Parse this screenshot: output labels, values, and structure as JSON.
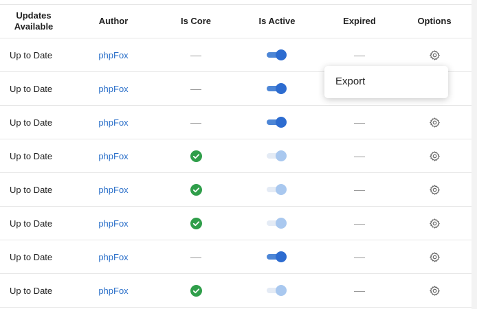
{
  "columns": {
    "updates": "Updates\nAvailable",
    "author": "Author",
    "is_core": "Is Core",
    "is_active": "Is Active",
    "expired": "Expired",
    "options": "Options"
  },
  "rows": [
    {
      "status": "Up to Date",
      "author": "phpFox",
      "is_core": false,
      "is_active": true,
      "expired": false
    },
    {
      "status": "Up to Date",
      "author": "phpFox",
      "is_core": false,
      "is_active": true,
      "expired": false
    },
    {
      "status": "Up to Date",
      "author": "phpFox",
      "is_core": false,
      "is_active": true,
      "expired": false
    },
    {
      "status": "Up to Date",
      "author": "phpFox",
      "is_core": true,
      "is_active": false,
      "expired": false
    },
    {
      "status": "Up to Date",
      "author": "phpFox",
      "is_core": true,
      "is_active": false,
      "expired": false
    },
    {
      "status": "Up to Date",
      "author": "phpFox",
      "is_core": true,
      "is_active": false,
      "expired": false
    },
    {
      "status": "Up to Date",
      "author": "phpFox",
      "is_core": false,
      "is_active": true,
      "expired": false
    },
    {
      "status": "Up to Date",
      "author": "phpFox",
      "is_core": true,
      "is_active": false,
      "expired": false
    }
  ],
  "options_menu": {
    "open_on_row": 1,
    "items": [
      "Export"
    ]
  },
  "icons": {
    "options": "gear-icon",
    "core": "check-circle-icon",
    "none": "dash-icon"
  },
  "colors": {
    "link": "#2a6fc9",
    "check": "#2f9e4a",
    "toggle_on": "#2d6cd0",
    "toggle_off": "#a9c8ef"
  }
}
